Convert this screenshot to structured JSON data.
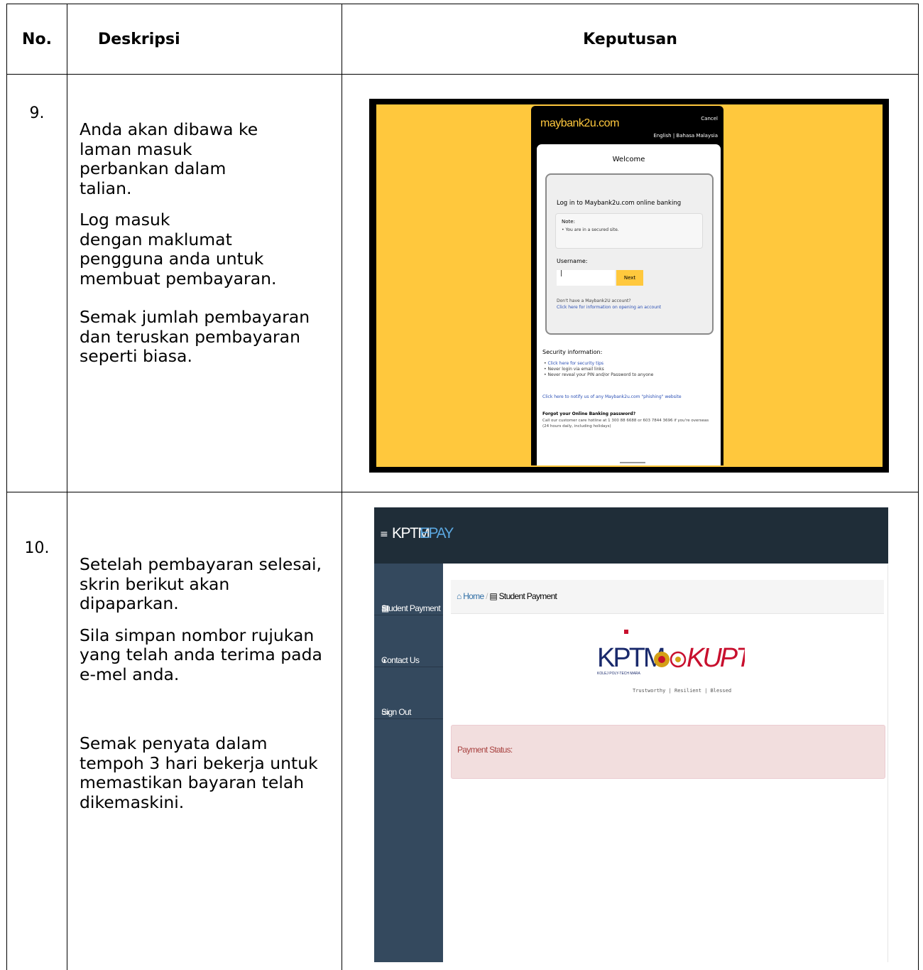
{
  "table": {
    "headers": {
      "no": "No.",
      "desc": "Deskripsi",
      "result": "Keputusan"
    },
    "rows": [
      {
        "no": "9.",
        "desc": [
          "Anda akan dibawa ke",
          "laman masuk",
          "perbankan dalam",
          "talian.",
          "",
          "Log masuk",
          "dengan maklumat",
          "pengguna anda untuk",
          "membuat pembayaran.",
          "",
          "Semak jumlah pembayaran",
          "dan teruskan pembayaran",
          "seperti biasa."
        ]
      },
      {
        "no": "10.",
        "desc": [
          "Setelah pembayaran selesai,",
          "skrin berikut akan",
          "dipaparkan.",
          "",
          "Sila simpan nombor rujukan",
          "yang telah anda terima pada",
          "e-mel anda.",
          "",
          "",
          "Semak penyata dalam",
          "tempoh 3 hari bekerja untuk",
          "memastikan bayaran telah",
          "dikemaskini."
        ]
      }
    ]
  },
  "maybank": {
    "logo": "maybank2u.com",
    "cancel": "Cancel",
    "lang": "English | Bahasa Malaysia",
    "welcome": "Welcome",
    "login_title": "Log in to Maybank2u.com online banking",
    "note_title": "Note:",
    "note_body": "• You are in a secured site.",
    "username_label": "Username:",
    "username_value": "|",
    "next": "Next",
    "no_account": "Don't have a Maybank2U account?",
    "open_account": "Click here for information on opening an account",
    "security_title": "Security information:",
    "security_1": "Click here for security tips",
    "security_2": "Never login via email links",
    "security_3": "Never reveal your PIN and/or Password to anyone",
    "phishing": "Click here to notify us of any Maybank2u.com \"phishing\" website",
    "forgot_title": "Forgot your Online Banking password?",
    "forgot_body": "Call our customer care hotline at 1 300 88 6688 or 603 7844 3696 if you're overseas (24 hours daily, including holidays)",
    "accent": "#ffc83d"
  },
  "kptm": {
    "logo_a": "KPTM",
    "logo_b": "EPAY",
    "menu": [
      "Student Payment",
      "Contact Us",
      "Sign Out"
    ],
    "breadcrumb_home": "Home",
    "breadcrumb_sep": "/",
    "breadcrumb_current": "Student Payment",
    "brand_left": "KPTM",
    "brand_left_sub": "KOLEJ POLY-TECH MARA",
    "brand_right": "KUPTM",
    "tagline": "Trustworthy | Resilient | Blessed",
    "status": "Payment Status:"
  }
}
